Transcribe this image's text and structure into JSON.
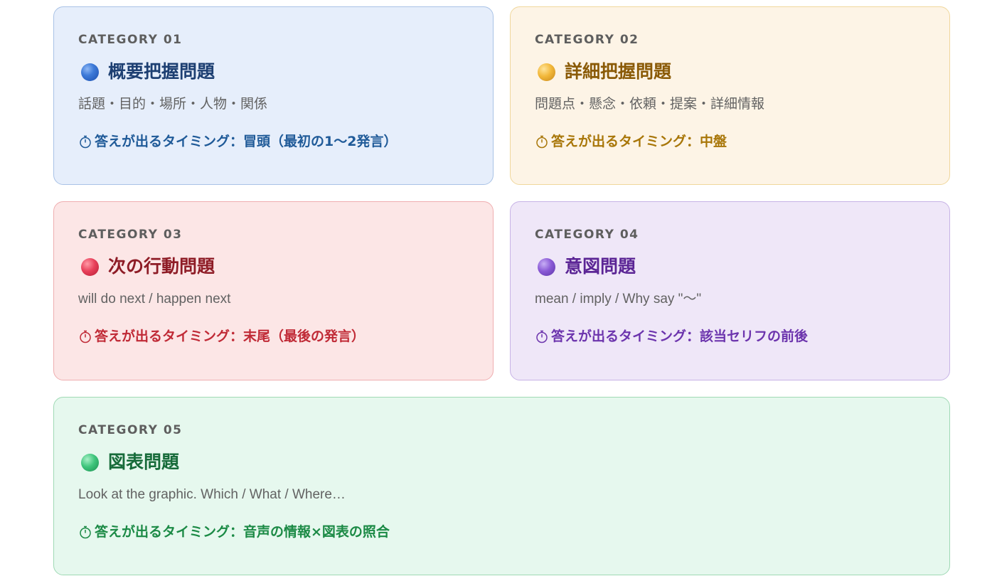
{
  "cards": [
    {
      "category": "CATEGORY 01",
      "title": "概要把握問題",
      "description": "話題・目的・場所・人物・関係",
      "timing": "答えが出るタイミング：冒頭（最初の1〜2発言）",
      "dot_icon": "blue-circle-icon",
      "accent": "#1f5a98"
    },
    {
      "category": "CATEGORY 02",
      "title": "詳細把握問題",
      "description": "問題点・懸念・依頼・提案・詳細情報",
      "timing": "答えが出るタイミング：中盤",
      "dot_icon": "yellow-circle-icon",
      "accent": "#a87608"
    },
    {
      "category": "CATEGORY 03",
      "title": "次の行動問題",
      "description": "will do next / happen next",
      "timing": "答えが出るタイミング：末尾（最後の発言）",
      "dot_icon": "red-circle-icon",
      "accent": "#c02a36"
    },
    {
      "category": "CATEGORY 04",
      "title": "意図問題",
      "description": "mean / imply / Why say \"〜\"",
      "timing": "答えが出るタイミング：該当セリフの前後",
      "dot_icon": "purple-circle-icon",
      "accent": "#6c34ad"
    },
    {
      "category": "CATEGORY 05",
      "title": "図表問題",
      "description": "Look at the graphic. Which / What / Where…",
      "timing": "答えが出るタイミング：音声の情報×図表の照合",
      "dot_icon": "green-circle-icon",
      "accent": "#1b8a45"
    }
  ],
  "timer_icon": "stopwatch-icon"
}
